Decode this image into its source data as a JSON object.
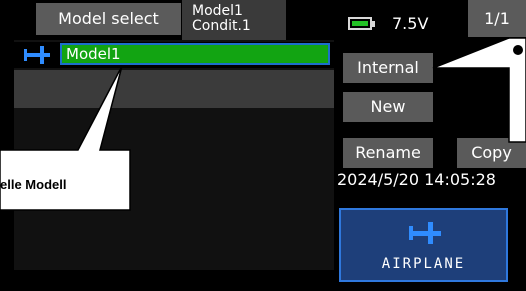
{
  "header": {
    "title": "Model select",
    "model_line": "Model1",
    "condition_line": "Condit.1",
    "voltage": "7.5V",
    "page": "1/1"
  },
  "model_list": {
    "items": [
      {
        "name": "Model1",
        "selected": true
      }
    ]
  },
  "buttons": {
    "internal": "Internal",
    "new": "New",
    "rename": "Rename",
    "copy": "Copy"
  },
  "datetime": "2024/5/20 14:05:28",
  "model_type": {
    "label": "AIRPLANE",
    "icon": "airplane-icon"
  },
  "callouts": {
    "left_label": "elle Modell"
  },
  "colors": {
    "screen_bg": "#000000",
    "selected_row": "#12a412",
    "selected_border": "#1d6fcc",
    "button_bg": "#5a5a5a",
    "battery_green": "#23c125",
    "type_box_bg": "#1e3f7a",
    "icon_blue": "#2f8cff"
  }
}
